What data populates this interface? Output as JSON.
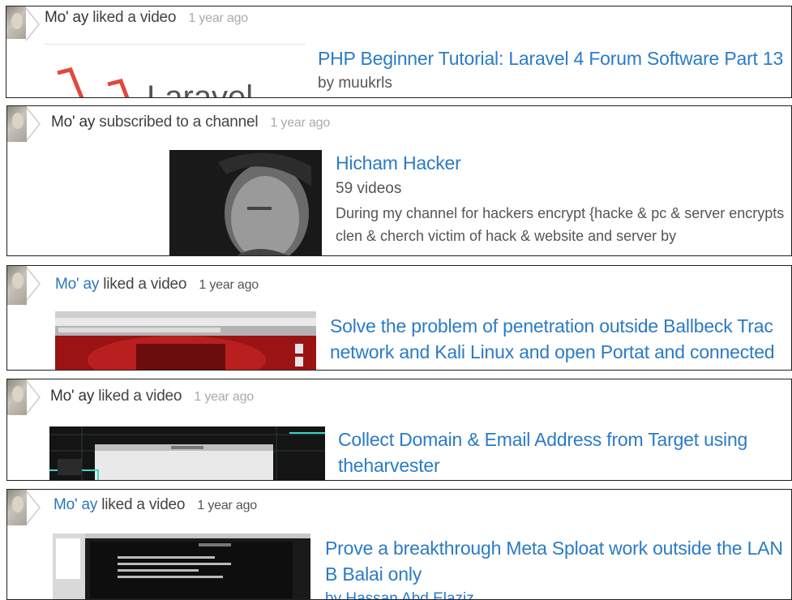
{
  "feed": [
    {
      "user": "Mo' ay",
      "action": "liked a video",
      "time": "1 year ago",
      "title": "PHP Beginner Tutorial: Laravel 4 Forum Software Part 13",
      "byline": "by muukrls",
      "thumbnail_text": "Laravel",
      "thumbnail": "laravel-logo-thumbnail"
    },
    {
      "user": "Mo' ay",
      "action": "subscribed to a channel",
      "time": "1 year ago",
      "title": "Hicham Hacker",
      "videos": "59 videos",
      "description": "During my channel for hackers encrypt {hacke & pc & server encrypts clen & cherch victim of hack & website and server by",
      "thumbnail": "channel-portrait-thumbnail"
    },
    {
      "user": "Mo' ay",
      "action": "liked a video",
      "time": "1 year ago",
      "title": "Solve the problem of penetration outside Ballbeck Trac network and Kali Linux and open Portat and connected",
      "thumbnail": "red-desktop-thumbnail"
    },
    {
      "user": "Mo' ay",
      "action": "liked a video",
      "time": "1 year ago",
      "title": "Collect Domain & Email Address from Target using theharvester",
      "thumbnail": "dark-grid-desktop-thumbnail"
    },
    {
      "user": "Mo' ay",
      "action": "liked a video",
      "time": "1 year ago",
      "title": "Prove a breakthrough Meta Sploat work outside the LAN B Balai only",
      "byline": "by Hassan Abd Elaziz",
      "thumbnail": "terminal-thumbnail"
    }
  ]
}
